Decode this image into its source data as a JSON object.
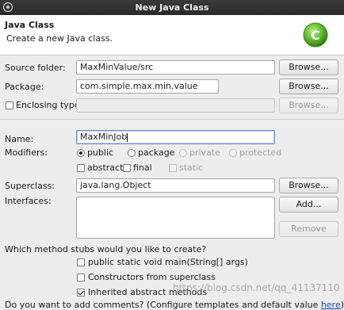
{
  "window": {
    "title": "New Java Class"
  },
  "header": {
    "title": "Java Class",
    "message": "Create a new Java class.",
    "icon": "java-class-wizard-icon",
    "icon_letter": "C"
  },
  "form": {
    "source_folder": {
      "label": "Source folder:",
      "value": "MaxMinValue/src",
      "button": "Browse..."
    },
    "package": {
      "label": "Package:",
      "value": "com.simple.max.min.value",
      "button": "Browse..."
    },
    "enclosing_type": {
      "label": "Enclosing type:",
      "value": "",
      "button": "Browse...",
      "checked": false
    },
    "name": {
      "label": "Name:",
      "value": "MaxMinJob"
    },
    "modifiers": {
      "label": "Modifiers:",
      "visibility": [
        {
          "label": "public",
          "selected": true,
          "enabled": true
        },
        {
          "label": "package",
          "selected": false,
          "enabled": true
        },
        {
          "label": "private",
          "selected": false,
          "enabled": false
        },
        {
          "label": "protected",
          "selected": false,
          "enabled": false
        }
      ],
      "flags": [
        {
          "label": "abstract",
          "checked": false,
          "enabled": true
        },
        {
          "label": "final",
          "checked": false,
          "enabled": true
        },
        {
          "label": "static",
          "checked": false,
          "enabled": false
        }
      ]
    },
    "superclass": {
      "label": "Superclass:",
      "value": "java.lang.Object",
      "button": "Browse..."
    },
    "interfaces": {
      "label": "Interfaces:",
      "add_button": "Add...",
      "remove_button": "Remove",
      "items": []
    },
    "stubs": {
      "question": "Which method stubs would you like to create?",
      "options": [
        {
          "label": "public static void main(String[] args)",
          "checked": false
        },
        {
          "label": "Constructors from superclass",
          "checked": false
        },
        {
          "label": "Inherited abstract methods",
          "checked": true
        }
      ]
    },
    "comments": {
      "question_prefix": "Do you want to add comments? (Configure templates and default value ",
      "link": "here",
      "question_suffix": ")"
    }
  },
  "watermark": "https://blog.csdn.net/qq_41137110",
  "colors": {
    "title_bar": "#2f2f2f",
    "icon_green": "#5cb82e",
    "link": "#1a3fb0"
  }
}
